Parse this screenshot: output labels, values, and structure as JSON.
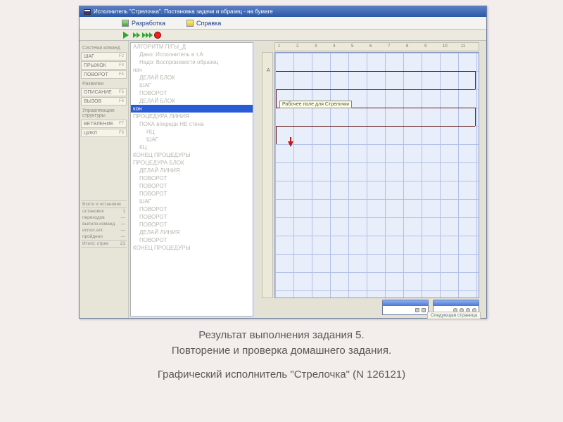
{
  "title": "Исполнитель \"Стрелочка\". Постановка задачи и образец - на бумаге",
  "menu": {
    "item1": "Разработка",
    "item2": "Справка"
  },
  "palette": {
    "section1": "Система команд",
    "btns1": [
      {
        "label": "ШАГ",
        "key": "F2"
      },
      {
        "label": "ПРЫЖОК",
        "key": "F3"
      },
      {
        "label": "ПОВОРОТ",
        "key": "F4"
      }
    ],
    "section2": "Развилки",
    "btns2": [
      {
        "label": "ОПИСАНИЕ",
        "key": "F5"
      },
      {
        "label": "ВЫЗОВ",
        "key": "F6"
      }
    ],
    "section3": "Управляющие структуры",
    "btns3": [
      {
        "label": "ВЕТВЛЕНИЕ",
        "key": "F7"
      },
      {
        "label": "ЦИКЛ",
        "key": "F8"
      }
    ],
    "resultsHeader": "Взято и остановок",
    "rows": [
      {
        "l": "остановок",
        "r": "1"
      },
      {
        "l": "переходов",
        "r": "—"
      },
      {
        "l": "выполн.команд",
        "r": "—"
      },
      {
        "l": "испол.алг.",
        "r": "—"
      },
      {
        "l": "пройдено",
        "r": "—"
      }
    ],
    "totalL": "Итого: стрек",
    "totalR": "21"
  },
  "code": [
    "АЛГОРИТМ П/ГЫ_Д",
    "Дано: Исполнитель в т.А",
    "Надо: Воспроизвести образец",
    "нач",
    "ДЕЛАЙ БЛОК",
    "ШАГ",
    "ПОВОРОТ",
    "ДЕЛАЙ БЛОК",
    "кон",
    "ПРОЦЕДУРА ЛИНИЯ",
    "ПОКА впереди НЕ стена",
    "НЦ",
    "ШАГ",
    "КЦ",
    "КОНЕЦ ПРОЦЕДУРЫ",
    "ПРОЦЕДУРА БЛОК",
    "ДЕЛАЙ ЛИНИЯ",
    "ПОВОРОТ",
    "ПОВОРОТ",
    "ПОВОРОТ",
    "ШАГ",
    "ПОВОРОТ",
    "ПОВОРОТ",
    "ПОВОРОТ",
    "ДЕЛАЙ ЛИНИЯ",
    "ПОВОРОТ",
    "КОНЕЦ ПРОЦЕДУРЫ"
  ],
  "codeSelectedIndex": 8,
  "codeIndents": {
    "1": 1,
    "2": 1,
    "4": 1,
    "5": 1,
    "6": 1,
    "7": 1,
    "10": 1,
    "11": 2,
    "12": 2,
    "13": 1,
    "16": 1,
    "17": 1,
    "18": 1,
    "19": 1,
    "20": 1,
    "21": 1,
    "22": 1,
    "23": 1,
    "24": 1,
    "25": 1
  },
  "tooltip": "Рабочее поле для Стрелочки",
  "ruler": [
    "1",
    "2",
    "3",
    "4",
    "5",
    "6",
    "7",
    "8",
    "9",
    "10",
    "11"
  ],
  "gridStart": "A",
  "nextPage": "Следующая страница",
  "caption": {
    "l1": "Результат выполнения задания 5.",
    "l2": "Повторение и проверка домашнего задания.",
    "l3": "Графический исполнитель \"Стрелочка\" (N 126121)"
  }
}
